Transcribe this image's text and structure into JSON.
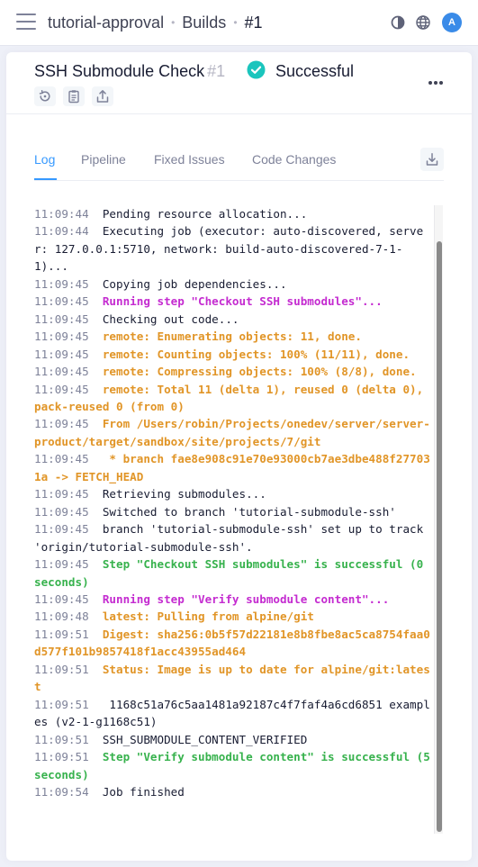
{
  "breadcrumb": {
    "project": "tutorial-approval",
    "section": "Builds",
    "current": "#1",
    "sep": "•"
  },
  "user": {
    "avatar_initial": "A"
  },
  "build": {
    "title": "SSH Submodule Check",
    "number": "#1",
    "status": "Successful"
  },
  "tabs": [
    {
      "label": "Log",
      "active": true
    },
    {
      "label": "Pipeline",
      "active": false
    },
    {
      "label": "Fixed Issues",
      "active": false
    },
    {
      "label": "Code Changes",
      "active": false
    }
  ],
  "icons": {
    "menu": "hamburger-icon",
    "theme": "contrast-icon",
    "language": "globe-icon",
    "status": "check-circle-icon",
    "more": "more-dots-icon",
    "rebuild": "rebuild-icon",
    "copy": "clipboard-icon",
    "share": "share-icon",
    "download": "download-icon"
  },
  "colors": {
    "accent": "#3699ff",
    "success": "#1bc5bd",
    "warning": "#e19527",
    "step": "#c42bd0",
    "ok": "#37b24d"
  },
  "log": [
    {
      "ts": "11:09:44",
      "msg": "Pending resource allocation...",
      "style": "n"
    },
    {
      "ts": "11:09:44",
      "msg": "Executing job (executor: auto-discovered, server: 127.0.0.1:5710, network: build-auto-discovered-7-1-1)...",
      "style": "n"
    },
    {
      "ts": "11:09:45",
      "msg": "Copying job dependencies...",
      "style": "n"
    },
    {
      "ts": "11:09:45",
      "msg": "Running step \"Checkout SSH submodules\"...",
      "style": "p"
    },
    {
      "ts": "11:09:45",
      "msg": "Checking out code...",
      "style": "n"
    },
    {
      "ts": "11:09:45",
      "msg": "remote: Enumerating objects: 11, done.",
      "style": "w"
    },
    {
      "ts": "11:09:45",
      "msg": "remote: Counting objects: 100% (11/11), done.",
      "style": "w"
    },
    {
      "ts": "11:09:45",
      "msg": "remote: Compressing objects: 100% (8/8), done.",
      "style": "w"
    },
    {
      "ts": "11:09:45",
      "msg": "remote: Total 11 (delta 1), reused 0 (delta 0), pack-reused 0 (from 0)",
      "style": "w"
    },
    {
      "ts": "11:09:45",
      "msg": "From /Users/robin/Projects/onedev/server/server-product/target/sandbox/site/projects/7/git",
      "style": "w"
    },
    {
      "ts": "11:09:45",
      "msg": " * branch fae8e908c91e70e93000cb7ae3dbe488f277031a -> FETCH_HEAD",
      "style": "w"
    },
    {
      "ts": "11:09:45",
      "msg": "Retrieving submodules...",
      "style": "n"
    },
    {
      "ts": "11:09:45",
      "msg": "Switched to branch 'tutorial-submodule-ssh'",
      "style": "n"
    },
    {
      "ts": "11:09:45",
      "msg": "branch 'tutorial-submodule-ssh' set up to track 'origin/tutorial-submodule-ssh'.",
      "style": "n"
    },
    {
      "ts": "11:09:45",
      "msg": "Step \"Checkout SSH submodules\" is successful (0 seconds)",
      "style": "g"
    },
    {
      "ts": "11:09:45",
      "msg": "Running step \"Verify submodule content\"...",
      "style": "p"
    },
    {
      "ts": "11:09:48",
      "msg": "latest: Pulling from alpine/git",
      "style": "w"
    },
    {
      "ts": "11:09:51",
      "msg": "Digest: sha256:0b5f57d22181e8b8fbe8ac5ca8754faa0d577f101b9857418f1acc43955ad464",
      "style": "w"
    },
    {
      "ts": "11:09:51",
      "msg": "Status: Image is up to date for alpine/git:latest",
      "style": "w"
    },
    {
      "ts": "11:09:51",
      "msg": " 1168c51a76c5aa1481a92187c4f7faf4a6cd6851 examples (v2-1-g1168c51)",
      "style": "n"
    },
    {
      "ts": "11:09:51",
      "msg": "SSH_SUBMODULE_CONTENT_VERIFIED",
      "style": "n"
    },
    {
      "ts": "11:09:51",
      "msg": "Step \"Verify submodule content\" is successful (5 seconds)",
      "style": "g"
    },
    {
      "ts": "11:09:54",
      "msg": "Job finished",
      "style": "n"
    }
  ]
}
